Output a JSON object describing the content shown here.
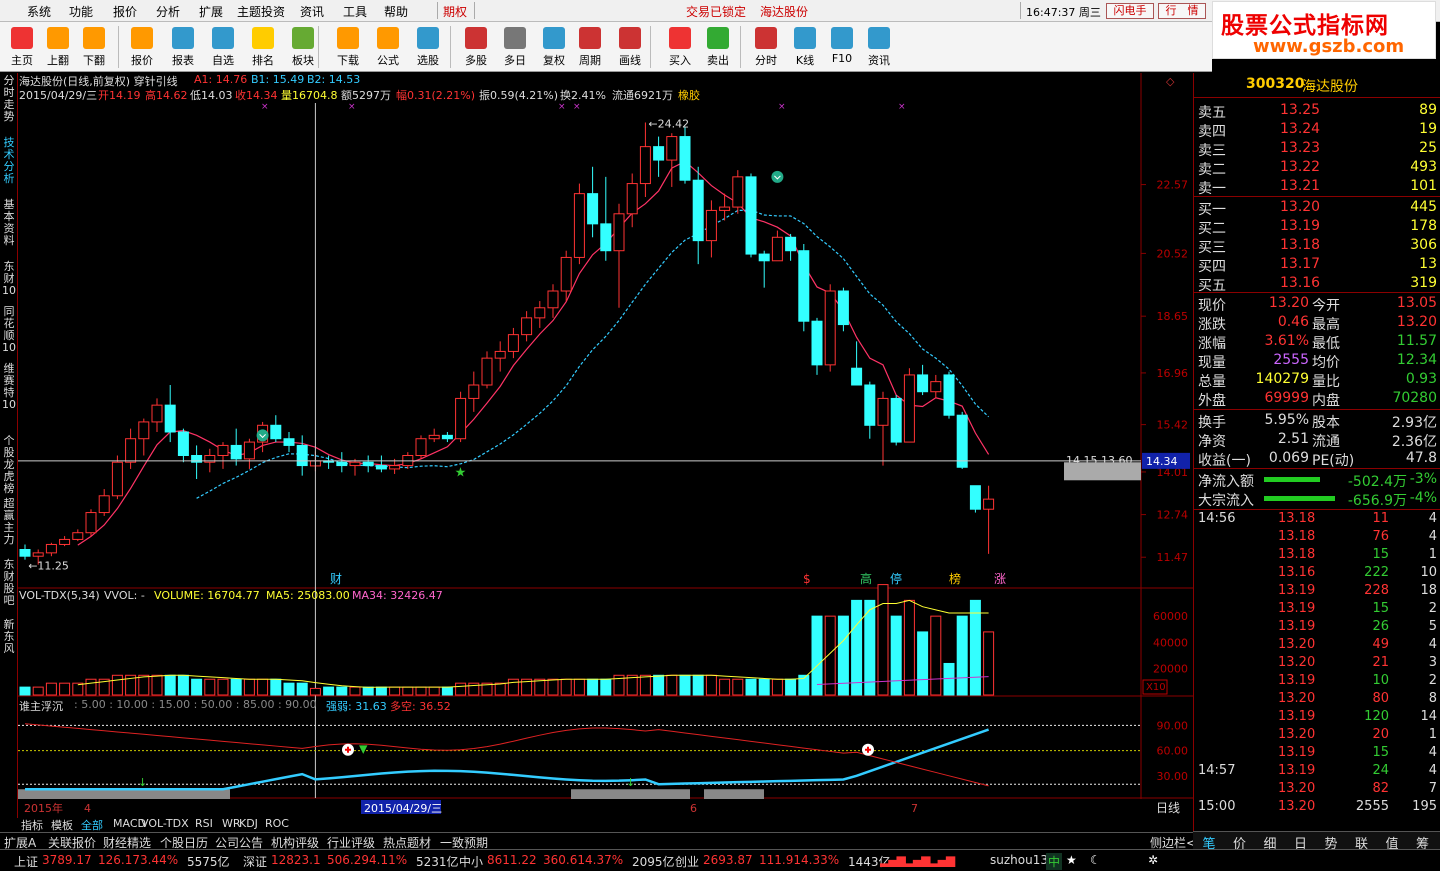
{
  "menu": {
    "items": [
      "系统",
      "功能",
      "报价",
      "分析",
      "扩展",
      "主题投资",
      "资讯",
      "工具",
      "帮助"
    ],
    "period_tag": "期权",
    "trade_locked": "交易已锁定",
    "stock_name": "海达股份",
    "clock": "16:47:37 周三",
    "flash_btn": "闪电手",
    "quote_btn": "行　情"
  },
  "brand": {
    "line1": "股票公式指标网",
    "line2": "www.gszb.com"
  },
  "toolbar": [
    {
      "label": "主页",
      "icon": "home-icon",
      "color": "#e33"
    },
    {
      "label": "上翻",
      "icon": "up-arrow-icon",
      "color": "#f90"
    },
    {
      "label": "下翻",
      "icon": "down-arrow-icon",
      "color": "#f90"
    },
    {
      "label": "报价",
      "icon": "yuan-icon",
      "color": "#f90"
    },
    {
      "label": "报表",
      "icon": "report-icon",
      "color": "#39c"
    },
    {
      "label": "自选",
      "icon": "f6-icon",
      "color": "#39c"
    },
    {
      "label": "排名",
      "icon": "rank-icon",
      "color": "#fc0"
    },
    {
      "label": "板块",
      "icon": "sector-icon",
      "color": "#6a3"
    },
    {
      "label": "下载",
      "icon": "download-icon",
      "color": "#f90"
    },
    {
      "label": "公式",
      "icon": "formula-icon",
      "color": "#f90"
    },
    {
      "label": "选股",
      "icon": "stock-picker-icon",
      "color": "#39c"
    },
    {
      "label": "多股",
      "icon": "multi-stock-icon",
      "color": "#c33"
    },
    {
      "label": "多日",
      "icon": "clock-icon",
      "color": "#777"
    },
    {
      "label": "复权",
      "icon": "restore-rights-icon",
      "color": "#39c"
    },
    {
      "label": "周期",
      "icon": "f8-icon",
      "color": "#c33"
    },
    {
      "label": "画线",
      "icon": "draw-line-icon",
      "color": "#c33"
    },
    {
      "label": "买入",
      "icon": "buy-icon",
      "color": "#e33"
    },
    {
      "label": "卖出",
      "icon": "sell-icon",
      "color": "#3a3"
    },
    {
      "label": "分时",
      "icon": "intraday-icon",
      "color": "#c33"
    },
    {
      "label": "K线",
      "icon": "kline-icon",
      "color": "#39c"
    },
    {
      "label": "F10",
      "icon": "f10-icon",
      "color": "#39c"
    },
    {
      "label": "资讯",
      "icon": "news-icon",
      "color": "#39c"
    }
  ],
  "leftnav": [
    {
      "label": "分时走势",
      "active": false
    },
    {
      "label": "技术分析",
      "active": true
    },
    {
      "label": "基本资料",
      "active": false
    },
    {
      "label": "东财10",
      "active": false
    },
    {
      "label": "同花顺10",
      "active": false
    },
    {
      "label": "维赛特10",
      "active": false
    },
    {
      "label": "个股龙虎榜",
      "active": false
    },
    {
      "label": "超赢主力",
      "active": false
    },
    {
      "label": "东财股吧",
      "active": false
    },
    {
      "label": "新东风",
      "active": false
    }
  ],
  "kline": {
    "title": "海达股份(日线,前复权) 穿针引线",
    "a1": "A1: 14.76",
    "b1": "B1: 15.49",
    "b2": "B2: 14.53",
    "date": "2015/04/29/三",
    "open": "开14.19",
    "high": "高14.62",
    "low": "低14.03",
    "close": "收14.34",
    "vol": "量16704.8",
    "amt": "额5297万",
    "rng": "幅0.31(2.21%)",
    "amp": "振0.59(4.21%)",
    "turn": "换2.41%",
    "float": "流通6921万",
    "tag": "橡胶",
    "axis": [
      "22.57",
      "20.52",
      "18.65",
      "16.96",
      "15.42",
      "14.01",
      "12.74",
      "11.47"
    ],
    "cursor_price": "14.34",
    "hi_label": "24.42",
    "lo_label": "11.25",
    "right_labels": "14.15  13.60",
    "events": [
      {
        "t": "财",
        "c": "#3cf"
      },
      {
        "t": "$",
        "c": "#f33"
      },
      {
        "t": "高",
        "c": "#3c6"
      },
      {
        "t": "停",
        "c": "#3cf"
      },
      {
        "t": "榜",
        "c": "#fc0"
      },
      {
        "t": "涨",
        "c": "#f6c"
      }
    ]
  },
  "volume": {
    "name": "VOL-TDX(5,34)",
    "vvol": "VVOL: -",
    "volume": "VOLUME: 16704.77",
    "ma5": "MA5: 25083.00",
    "ma34": "MA34: 32426.47",
    "axis": [
      "60000",
      "40000",
      "20000"
    ],
    "unit": "X10"
  },
  "indicator": {
    "name": "谁主浮沉",
    "params": ": 5.00 : 10.00 : 15.00 : 50.00 : 85.00 : 90.00",
    "strong": "强弱: 31.63",
    "bear": "多空: 36.52",
    "axis": [
      "90.00",
      "60.00",
      "30.00"
    ]
  },
  "timeaxis": {
    "year": "2015年",
    "m4": "4",
    "date": "2015/04/29/三",
    "m6": "6",
    "m7": "7",
    "period": "日线"
  },
  "bottomtabs": [
    "指标",
    "模板",
    "全部",
    "MACD",
    "VOL-TDX",
    "RSI",
    "WR",
    "KDJ",
    "ROC"
  ],
  "status1": [
    "扩展A",
    "关联报价",
    "财经精选",
    "个股日历",
    "公司公告",
    "机构评级",
    "行业评级",
    "热点题材",
    "一致预期"
  ],
  "status1_right": "侧边栏<",
  "status2": {
    "sh": "上证",
    "sh_v": "3789.17",
    "sh_c": "126.17",
    "sh_p": "3.44%",
    "sh_a": "5575亿",
    "sz": "深证",
    "sz_v": "12823.1",
    "sz_c": "506.29",
    "sz_p": "4.11%",
    "sz_a": "5231亿",
    "zx": "中小",
    "zx_v": "8611.22",
    "zx_c": "360.61",
    "zx_p": "4.37%",
    "zx_a": "2095亿",
    "cy": "创业",
    "cy_v": "2693.87",
    "cy_c": "111.91",
    "cy_p": "4.33%",
    "cy_a": "1443亿",
    "server": "suzhou13",
    "zhong": "中"
  },
  "quote": {
    "code": "300320",
    "name": "海达股份",
    "asks": [
      {
        "l": "卖五",
        "p": "13.25",
        "v": "89"
      },
      {
        "l": "卖四",
        "p": "13.24",
        "v": "19"
      },
      {
        "l": "卖三",
        "p": "13.23",
        "v": "25"
      },
      {
        "l": "卖二",
        "p": "13.22",
        "v": "493"
      },
      {
        "l": "卖一",
        "p": "13.21",
        "v": "101"
      }
    ],
    "bids": [
      {
        "l": "买一",
        "p": "13.20",
        "v": "445"
      },
      {
        "l": "买二",
        "p": "13.19",
        "v": "178"
      },
      {
        "l": "买三",
        "p": "13.18",
        "v": "306"
      },
      {
        "l": "买四",
        "p": "13.17",
        "v": "13"
      },
      {
        "l": "买五",
        "p": "13.16",
        "v": "319"
      }
    ],
    "stats": [
      {
        "l1": "现价",
        "v1": "13.20",
        "c1": "#f33",
        "l2": "今开",
        "v2": "13.05",
        "c2": "#f33"
      },
      {
        "l1": "涨跌",
        "v1": "0.46",
        "c1": "#f33",
        "l2": "最高",
        "v2": "13.20",
        "c2": "#f33"
      },
      {
        "l1": "涨幅",
        "v1": "3.61%",
        "c1": "#f33",
        "l2": "最低",
        "v2": "11.57",
        "c2": "#3c3"
      },
      {
        "l1": "现量",
        "v1": "2555",
        "c1": "#c6f",
        "l2": "均价",
        "v2": "12.34",
        "c2": "#3c3"
      },
      {
        "l1": "总量",
        "v1": "140279",
        "c1": "#ff3",
        "l2": "量比",
        "v2": "0.93",
        "c2": "#3c3"
      },
      {
        "l1": "外盘",
        "v1": "69999",
        "c1": "#f33",
        "l2": "内盘",
        "v2": "70280",
        "c2": "#3c3"
      }
    ],
    "stats2": [
      {
        "l1": "换手",
        "v1": "5.95%",
        "l2": "股本",
        "v2": "2.93亿"
      },
      {
        "l1": "净资",
        "v1": "2.51",
        "l2": "流通",
        "v2": "2.36亿"
      },
      {
        "l1": "收益(一)",
        "v1": "0.069",
        "l2": "PE(动)",
        "v2": "47.8"
      }
    ],
    "flows": [
      {
        "l": "净流入额",
        "v": "-502.4万",
        "p": "-3%",
        "bar": 0.78
      },
      {
        "l": "大宗流入",
        "v": "-656.9万",
        "p": "-4%",
        "bar": 0.98
      }
    ],
    "ticks": [
      {
        "t": "14:56",
        "p": "13.18",
        "v": "11",
        "n": "4",
        "pc": "#f33",
        "vc": "#f33"
      },
      {
        "t": "",
        "p": "13.18",
        "v": "76",
        "n": "4",
        "pc": "#f33",
        "vc": "#f33"
      },
      {
        "t": "",
        "p": "13.18",
        "v": "15",
        "n": "1",
        "pc": "#f33",
        "vc": "#3c3"
      },
      {
        "t": "",
        "p": "13.16",
        "v": "222",
        "n": "10",
        "pc": "#f33",
        "vc": "#3c3"
      },
      {
        "t": "",
        "p": "13.19",
        "v": "228",
        "n": "18",
        "pc": "#f33",
        "vc": "#f33"
      },
      {
        "t": "",
        "p": "13.19",
        "v": "15",
        "n": "2",
        "pc": "#f33",
        "vc": "#3c3"
      },
      {
        "t": "",
        "p": "13.19",
        "v": "26",
        "n": "5",
        "pc": "#f33",
        "vc": "#3c3"
      },
      {
        "t": "",
        "p": "13.20",
        "v": "49",
        "n": "4",
        "pc": "#f33",
        "vc": "#f33"
      },
      {
        "t": "",
        "p": "13.20",
        "v": "21",
        "n": "3",
        "pc": "#f33",
        "vc": "#f33"
      },
      {
        "t": "",
        "p": "13.19",
        "v": "10",
        "n": "2",
        "pc": "#f33",
        "vc": "#3c3"
      },
      {
        "t": "",
        "p": "13.20",
        "v": "80",
        "n": "8",
        "pc": "#f33",
        "vc": "#f33"
      },
      {
        "t": "",
        "p": "13.19",
        "v": "120",
        "n": "14",
        "pc": "#f33",
        "vc": "#3c3"
      },
      {
        "t": "",
        "p": "13.20",
        "v": "20",
        "n": "1",
        "pc": "#f33",
        "vc": "#f33"
      },
      {
        "t": "",
        "p": "13.19",
        "v": "15",
        "n": "4",
        "pc": "#f33",
        "vc": "#3c3"
      },
      {
        "t": "14:57",
        "p": "13.19",
        "v": "24",
        "n": "4",
        "pc": "#f33",
        "vc": "#3c3"
      },
      {
        "t": "",
        "p": "13.20",
        "v": "82",
        "n": "7",
        "pc": "#f33",
        "vc": "#f33"
      },
      {
        "t": "15:00",
        "p": "13.20",
        "v": "2555",
        "n": "195",
        "pc": "#f33",
        "vc": "#ddd"
      }
    ],
    "tabs": [
      "笔",
      "价",
      "细",
      "日",
      "势",
      "联",
      "值",
      "筹"
    ]
  },
  "chart_data": {
    "type": "candlestick",
    "ohlc": [
      [
        11.7,
        11.85,
        11.4,
        11.5
      ],
      [
        11.5,
        11.7,
        11.25,
        11.6
      ],
      [
        11.6,
        11.9,
        11.5,
        11.85
      ],
      [
        11.85,
        12.1,
        11.8,
        12.0
      ],
      [
        12.0,
        12.3,
        11.95,
        12.2
      ],
      [
        12.2,
        12.9,
        12.1,
        12.8
      ],
      [
        12.8,
        13.5,
        12.7,
        13.3
      ],
      [
        13.3,
        14.5,
        13.2,
        14.3
      ],
      [
        14.3,
        15.3,
        14.1,
        15.0
      ],
      [
        15.0,
        15.6,
        14.5,
        15.5
      ],
      [
        15.5,
        16.2,
        15.2,
        16.0
      ],
      [
        16.0,
        16.6,
        14.9,
        15.2
      ],
      [
        15.2,
        15.3,
        14.3,
        14.5
      ],
      [
        14.5,
        14.8,
        13.8,
        14.3
      ],
      [
        14.3,
        14.7,
        14.0,
        14.5
      ],
      [
        14.5,
        14.9,
        14.1,
        14.8
      ],
      [
        14.8,
        15.3,
        14.2,
        14.4
      ],
      [
        14.4,
        15.0,
        14.1,
        14.9
      ],
      [
        14.9,
        15.5,
        14.6,
        15.4
      ],
      [
        15.4,
        15.7,
        14.9,
        15.0
      ],
      [
        15.0,
        15.2,
        14.6,
        14.8
      ],
      [
        14.8,
        15.1,
        13.9,
        14.2
      ],
      [
        14.19,
        14.62,
        14.03,
        14.34
      ],
      [
        14.34,
        14.5,
        14.1,
        14.3
      ],
      [
        14.3,
        14.6,
        14.0,
        14.2
      ],
      [
        14.2,
        14.4,
        13.9,
        14.3
      ],
      [
        14.3,
        14.5,
        14.0,
        14.2
      ],
      [
        14.2,
        14.5,
        14.0,
        14.1
      ],
      [
        14.1,
        14.4,
        13.95,
        14.2
      ],
      [
        14.2,
        14.6,
        14.1,
        14.5
      ],
      [
        14.5,
        15.1,
        14.4,
        15.0
      ],
      [
        15.0,
        15.3,
        14.9,
        15.1
      ],
      [
        15.1,
        15.2,
        14.9,
        15.0
      ],
      [
        15.0,
        16.4,
        14.9,
        16.2
      ],
      [
        16.2,
        17.0,
        15.8,
        16.6
      ],
      [
        16.6,
        17.6,
        16.5,
        17.4
      ],
      [
        17.4,
        17.9,
        17.0,
        17.6
      ],
      [
        17.6,
        18.3,
        17.4,
        18.1
      ],
      [
        18.1,
        18.8,
        17.9,
        18.6
      ],
      [
        18.6,
        19.1,
        18.3,
        18.9
      ],
      [
        18.9,
        19.6,
        18.6,
        19.4
      ],
      [
        19.4,
        20.6,
        19.1,
        20.4
      ],
      [
        20.4,
        22.6,
        20.2,
        22.3
      ],
      [
        22.3,
        23.1,
        21.0,
        21.4
      ],
      [
        21.4,
        22.8,
        20.3,
        20.6
      ],
      [
        20.6,
        22.0,
        18.9,
        21.7
      ],
      [
        21.7,
        22.9,
        21.3,
        22.6
      ],
      [
        22.6,
        24.42,
        22.2,
        23.7
      ],
      [
        23.7,
        24.0,
        22.8,
        23.3
      ],
      [
        23.3,
        24.1,
        22.5,
        24.0
      ],
      [
        24.0,
        24.3,
        22.6,
        22.7
      ],
      [
        22.7,
        23.1,
        20.2,
        20.9
      ],
      [
        20.9,
        22.1,
        20.4,
        21.8
      ],
      [
        21.8,
        22.3,
        21.5,
        21.9
      ],
      [
        21.9,
        23.0,
        21.7,
        22.8
      ],
      [
        22.8,
        22.9,
        20.4,
        20.5
      ],
      [
        20.5,
        20.6,
        19.5,
        20.3
      ],
      [
        20.3,
        21.2,
        20.3,
        21.0
      ],
      [
        21.0,
        21.1,
        20.3,
        20.6
      ],
      [
        20.6,
        20.8,
        18.2,
        18.5
      ],
      [
        18.5,
        18.6,
        16.9,
        17.2
      ],
      [
        17.2,
        19.6,
        17.0,
        19.4
      ],
      [
        19.4,
        19.5,
        18.2,
        18.4
      ],
      [
        17.1,
        17.9,
        16.6,
        16.6
      ],
      [
        16.6,
        16.7,
        15.0,
        15.4
      ],
      [
        15.4,
        16.4,
        14.2,
        16.2
      ],
      [
        16.2,
        16.3,
        14.8,
        14.9
      ],
      [
        14.9,
        17.1,
        14.9,
        16.9
      ],
      [
        16.9,
        17.2,
        16.3,
        16.4
      ],
      [
        16.4,
        16.9,
        16.2,
        16.7
      ],
      [
        16.9,
        17.0,
        15.6,
        15.7
      ],
      [
        15.7,
        15.8,
        14.1,
        14.15
      ],
      [
        13.6,
        13.6,
        12.8,
        12.9
      ],
      [
        12.9,
        13.6,
        11.57,
        13.2
      ]
    ],
    "volume": [
      2,
      2,
      3,
      3,
      3,
      4,
      4,
      5,
      5,
      5,
      5,
      5,
      5,
      4,
      4,
      4,
      4,
      4,
      4,
      4,
      3,
      3,
      1.67,
      2,
      2,
      2,
      2,
      2,
      2,
      2,
      2,
      2,
      2,
      3,
      3,
      3,
      3,
      4,
      4,
      4,
      4,
      4,
      4,
      4,
      4,
      5,
      5,
      5,
      5,
      5,
      5,
      5,
      5,
      4,
      4,
      4,
      4,
      4,
      4,
      5,
      5,
      5,
      5,
      6,
      6,
      7,
      5,
      6,
      4,
      5,
      6,
      5,
      6,
      4
    ],
    "ylim": [
      11.0,
      25.0
    ],
    "xlabel": "",
    "ylabel": ""
  }
}
